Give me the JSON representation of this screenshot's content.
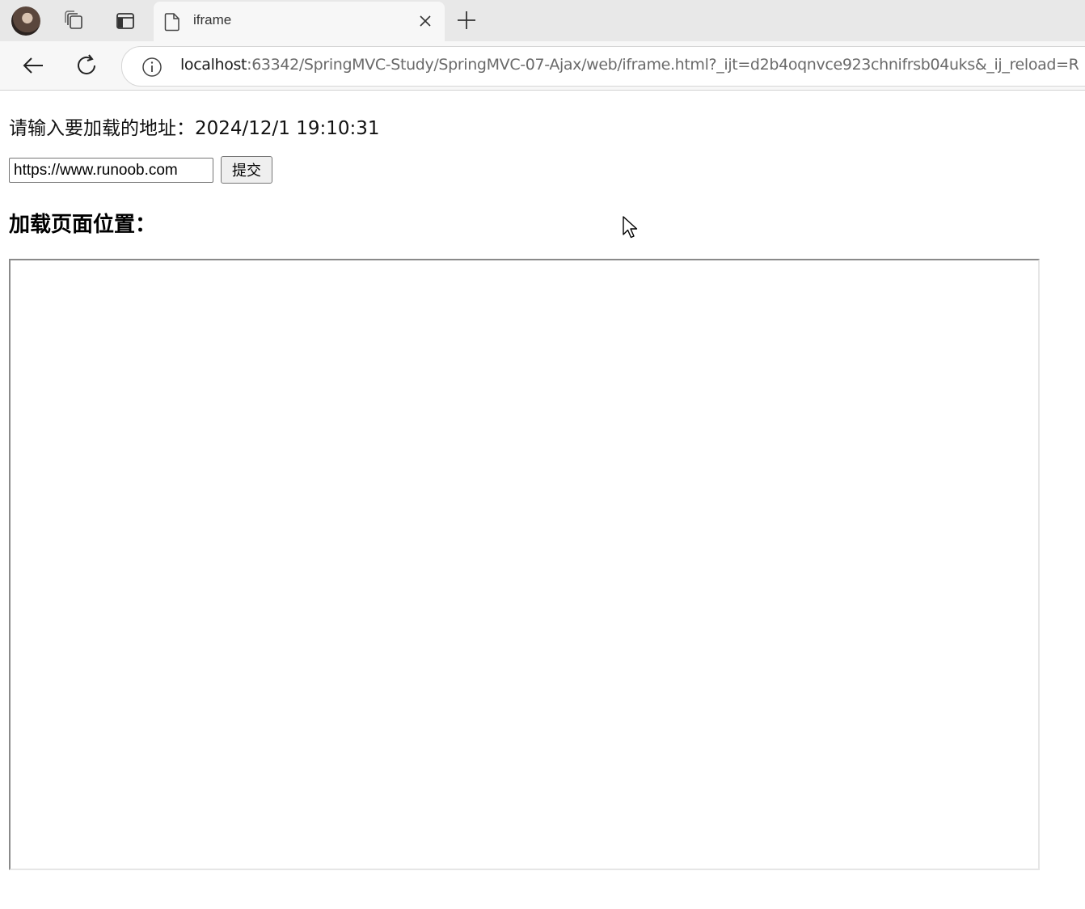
{
  "browser": {
    "tab": {
      "title": "iframe"
    },
    "address": {
      "host": "localhost",
      "rest": ":63342/SpringMVC-Study/SpringMVC-07-Ajax/web/iframe.html?_ijt=d2b4oqnvce923chnifrsb04uks&_ij_reload=R"
    },
    "icons": {
      "avatar": "profile-avatar",
      "workspaces": "workspaces-icon",
      "vertical_tabs": "vertical-tabs-icon",
      "tab_page": "page-icon",
      "tab_close": "close-icon",
      "new_tab": "plus-icon",
      "back": "back-arrow-icon",
      "refresh": "refresh-icon",
      "site_info": "info-icon"
    }
  },
  "page": {
    "prompt_label": "请输入要加载的地址：",
    "datetime": "2024/12/1 19:10:31",
    "url_input_value": "https://www.runoob.com",
    "submit_label": "提交",
    "section_title": "加载页面位置："
  }
}
